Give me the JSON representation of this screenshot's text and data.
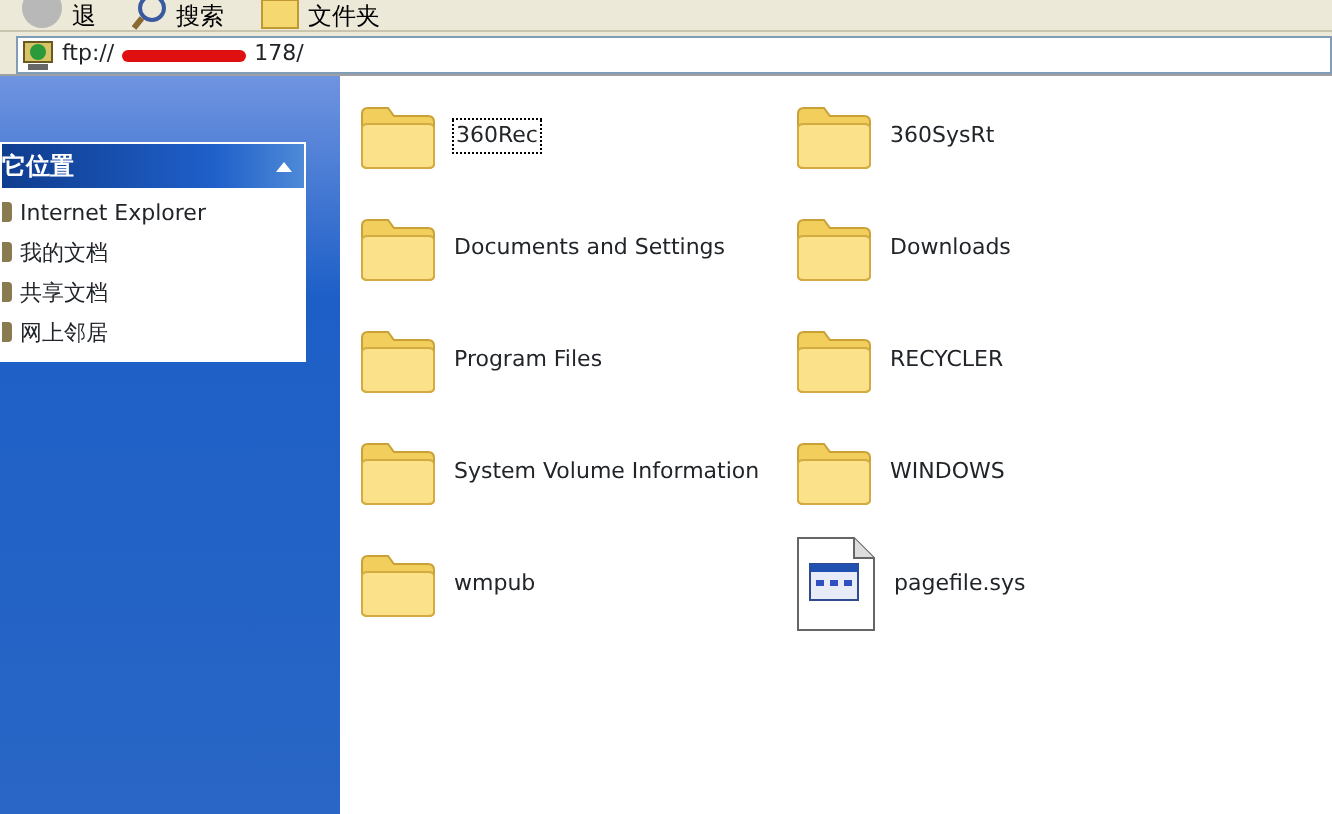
{
  "toolbar": {
    "buttons": [
      {
        "label": "退",
        "kind": "back"
      },
      {
        "label": "搜索",
        "kind": "search"
      },
      {
        "label": "文件夹",
        "kind": "folders"
      }
    ]
  },
  "address_bar": {
    "prefix": "ftp://",
    "suffix": "178/"
  },
  "side_panel": {
    "title": "它位置",
    "expanded": true,
    "items": [
      {
        "label": "Internet Explorer"
      },
      {
        "label": "我的文档"
      },
      {
        "label": "共享文档"
      },
      {
        "label": "网上邻居"
      }
    ]
  },
  "files": [
    {
      "name": "360Rec",
      "kind": "folder",
      "selected": true
    },
    {
      "name": "360SysRt",
      "kind": "folder",
      "selected": false
    },
    {
      "name": "Documents and Settings",
      "kind": "folder",
      "selected": false
    },
    {
      "name": "Downloads",
      "kind": "folder",
      "selected": false
    },
    {
      "name": "Program Files",
      "kind": "folder",
      "selected": false
    },
    {
      "name": "RECYCLER",
      "kind": "folder",
      "selected": false
    },
    {
      "name": "System Volume Information",
      "kind": "folder",
      "selected": false
    },
    {
      "name": "WINDOWS",
      "kind": "folder",
      "selected": false
    },
    {
      "name": "wmpub",
      "kind": "folder",
      "selected": false
    },
    {
      "name": "pagefile.sys",
      "kind": "file",
      "selected": false
    }
  ]
}
